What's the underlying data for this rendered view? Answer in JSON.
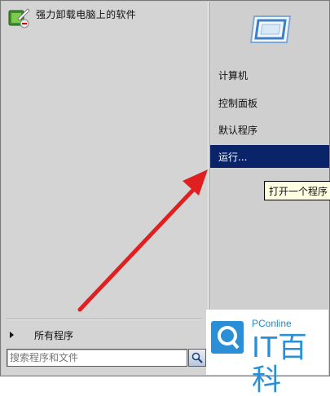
{
  "left_pane": {
    "pinned_program": {
      "label": "强力卸载电脑上的软件",
      "icon": "uninstaller-icon"
    },
    "all_programs_label": "所有程序",
    "search": {
      "value": "",
      "placeholder": "搜索程序和文件"
    }
  },
  "right_pane": {
    "user_tile_icon": "user-picture-frame-icon",
    "items": [
      {
        "label": "计算机"
      },
      {
        "label": "控制面板"
      },
      {
        "label": "默认程序"
      },
      {
        "label": "运行..."
      }
    ],
    "selected_index": 3,
    "tooltip": "打开一个程序"
  },
  "annotation": {
    "arrow_color": "#e02020"
  },
  "watermark": {
    "small_text": "PConline",
    "big_text": "IT百科",
    "color": "#2b8fd8"
  },
  "colors": {
    "selection": "#0a246a",
    "tooltip_bg": "#ffffe1"
  }
}
